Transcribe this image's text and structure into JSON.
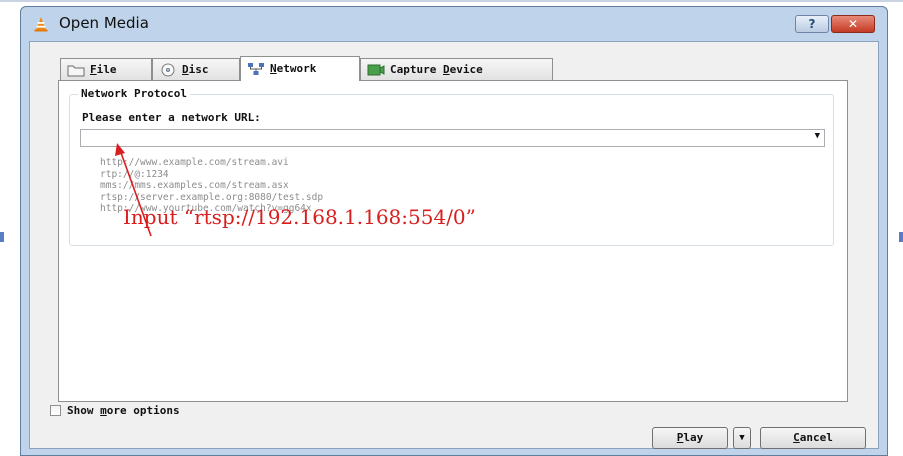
{
  "window": {
    "title": "Open Media",
    "help_label": "?",
    "close_label": "✕"
  },
  "tabs": [
    {
      "label_pre": "",
      "accel": "F",
      "label_post": "ile",
      "icon": "folder-icon"
    },
    {
      "label_pre": "",
      "accel": "D",
      "label_post": "isc",
      "icon": "disc-icon"
    },
    {
      "label_pre": "",
      "accel": "N",
      "label_post": "etwork",
      "icon": "network-icon",
      "active": true
    },
    {
      "label_pre": "Capture ",
      "accel": "D",
      "label_post": "evice",
      "icon": "capture-device-icon"
    }
  ],
  "network": {
    "group_title": "Network Protocol",
    "prompt": "Please enter a network URL:",
    "url_value": "",
    "examples": [
      "http://www.example.com/stream.avi",
      "rtp://@:1234",
      "mms://mms.examples.com/stream.asx",
      "rtsp://server.example.org:8080/test.sdp",
      "http://www.yourtube.com/watch?v=gg64x"
    ]
  },
  "annotation": {
    "text": "Input “rtsp://192.168.1.168:554/0”",
    "color": "#d81e1e"
  },
  "footer": {
    "more_options_pre": "Show ",
    "more_options_accel": "m",
    "more_options_post": "ore options",
    "play_accel": "P",
    "play_post": "lay",
    "cancel_accel": "C",
    "cancel_post": "ancel"
  },
  "colors": {
    "window_frame": "#bfd3ea",
    "client_bg": "#f0f0f0",
    "close_button": "#c43b24"
  }
}
